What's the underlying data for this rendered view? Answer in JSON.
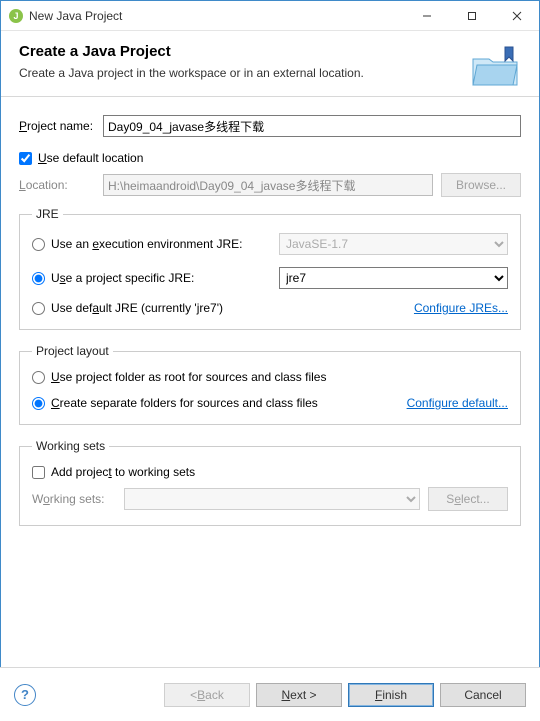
{
  "window": {
    "title": "New Java Project"
  },
  "header": {
    "title": "Create a Java Project",
    "subtitle": "Create a Java project in the workspace or in an external location."
  },
  "project": {
    "name_label": "Project name:",
    "name_value": "Day09_04_javase多线程下载",
    "use_default_label": "Use default location",
    "use_default_checked": true,
    "location_label": "Location:",
    "location_value": "H:\\heimaandroid\\Day09_04_javase多线程下载",
    "browse_label": "Browse..."
  },
  "jre": {
    "legend": "JRE",
    "exec_env_label": "Use an execution environment JRE:",
    "exec_env_value": "JavaSE-1.7",
    "project_specific_label": "Use a project specific JRE:",
    "project_specific_value": "jre7",
    "default_jre_label": "Use default JRE (currently 'jre7')",
    "selected": "project_specific",
    "configure_label": "Configure JREs..."
  },
  "layout": {
    "legend": "Project layout",
    "root_label": "Use project folder as root for sources and class files",
    "separate_label": "Create separate folders for sources and class files",
    "selected": "separate",
    "configure_label": "Configure default..."
  },
  "working_sets": {
    "legend": "Working sets",
    "add_label": "Add project to working sets",
    "add_checked": false,
    "label": "Working sets:",
    "select_label": "Select..."
  },
  "footer": {
    "back": "< Back",
    "next": "Next >",
    "finish": "Finish",
    "cancel": "Cancel"
  }
}
